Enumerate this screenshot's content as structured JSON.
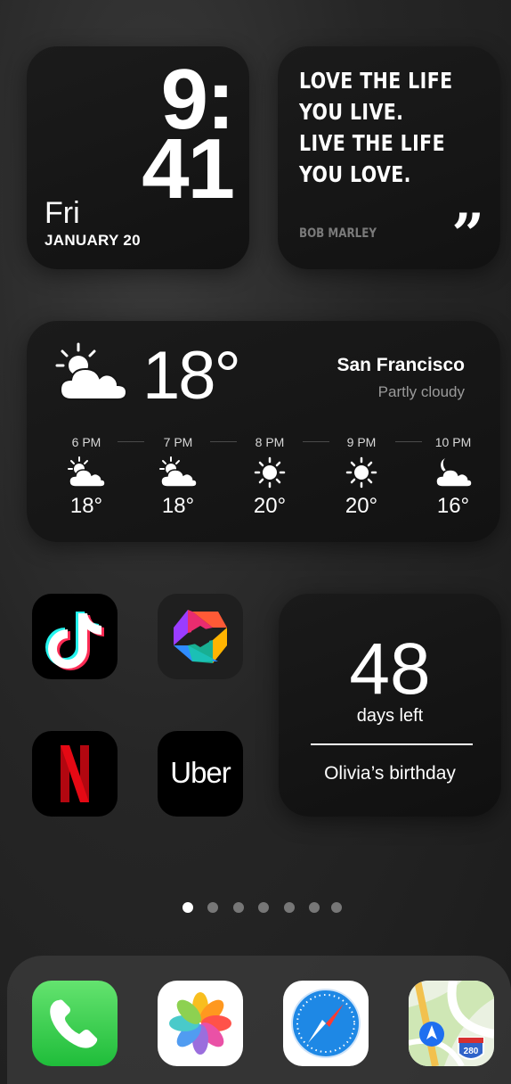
{
  "clock_widget": {
    "hour": "9:",
    "minute": "41",
    "day": "Fri",
    "date": "JANUARY 20"
  },
  "quote_widget": {
    "lines": [
      "LOVE THE LIFE",
      "YOU LIVE.",
      "LIVE THE LIFE",
      "YOU LOVE."
    ],
    "author": "BOB MARLEY",
    "quote_mark": "”"
  },
  "weather_widget": {
    "current_icon": "partly-cloudy-icon",
    "current_temp": "18°",
    "city": "San Francisco",
    "condition": "Partly cloudy",
    "hourly": [
      {
        "time": "6 PM",
        "icon": "partly-cloudy-icon",
        "temp": "18°"
      },
      {
        "time": "7 PM",
        "icon": "partly-cloudy-icon",
        "temp": "18°"
      },
      {
        "time": "8 PM",
        "icon": "sun-icon",
        "temp": "20°"
      },
      {
        "time": "9 PM",
        "icon": "sun-icon",
        "temp": "20°"
      },
      {
        "time": "10 PM",
        "icon": "moon-cloud-icon",
        "temp": "16°"
      }
    ]
  },
  "apps": {
    "tiktok": {
      "icon": "tiktok-icon"
    },
    "prisma": {
      "icon": "prisma-icon"
    },
    "netflix": {
      "icon": "netflix-icon"
    },
    "uber": {
      "label": "Uber"
    }
  },
  "countdown_widget": {
    "number": "48",
    "label": "days left",
    "event": "Olivia’s birthday"
  },
  "page_indicator": {
    "count": 7,
    "active_index": 0
  },
  "dock": {
    "apps": [
      {
        "icon": "phone-icon"
      },
      {
        "icon": "photos-icon"
      },
      {
        "icon": "safari-icon"
      },
      {
        "icon": "maps-icon",
        "badge": "280"
      }
    ]
  },
  "colors": {
    "accent_red": "#e50914",
    "safari_blue": "#1e88e5",
    "phone_green": "#2cc84a"
  }
}
